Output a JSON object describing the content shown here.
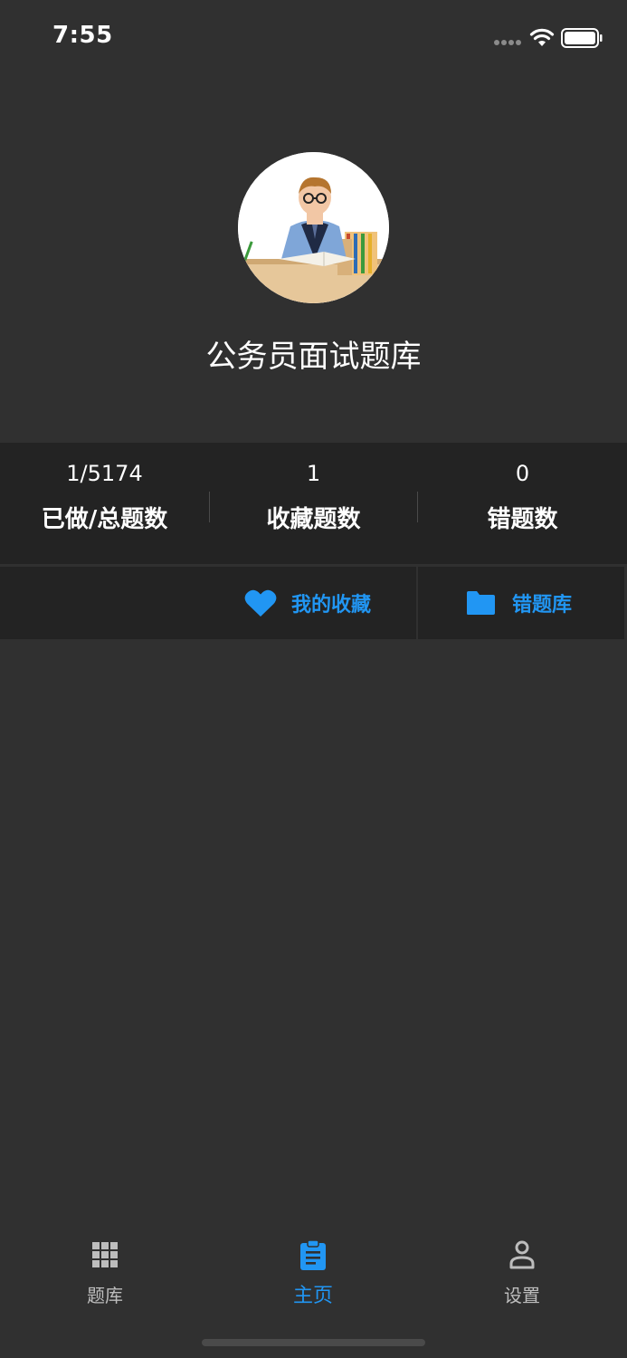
{
  "status_bar": {
    "time": "7:55"
  },
  "app_title": "公务员面试题库",
  "stats": [
    {
      "value": "1/5174",
      "label": "已做/总题数"
    },
    {
      "value": "1",
      "label": "收藏题数"
    },
    {
      "value": "0",
      "label": "错题数"
    }
  ],
  "actions": {
    "favorites": {
      "label": "我的收藏",
      "icon": "heart-icon"
    },
    "mistakes": {
      "label": "错题库",
      "icon": "folder-icon"
    }
  },
  "tabs": [
    {
      "label": "题库",
      "icon": "grid-icon",
      "active": false
    },
    {
      "label": "主页",
      "icon": "clipboard-icon",
      "active": true
    },
    {
      "label": "设置",
      "icon": "person-icon",
      "active": false
    }
  ],
  "colors": {
    "accent": "#2196f3",
    "background": "#303030",
    "panel": "#232323",
    "inactive": "#bdbdbd"
  }
}
